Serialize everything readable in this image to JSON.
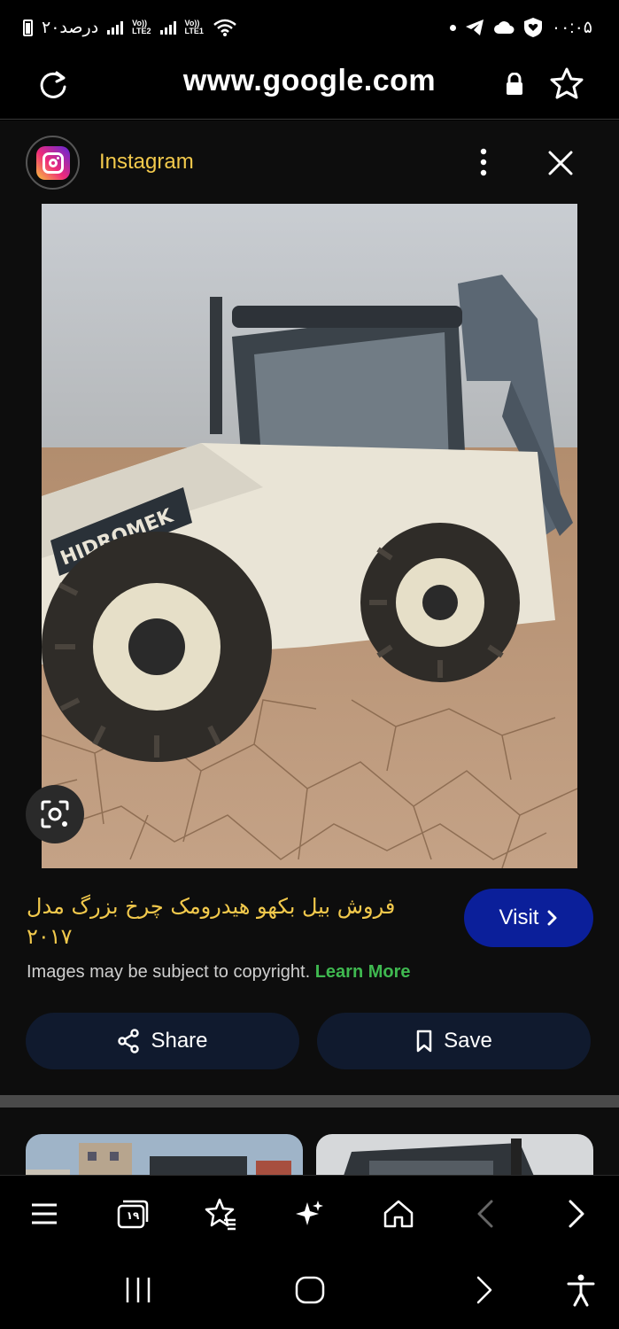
{
  "status": {
    "battery_text": "۲۰درصد",
    "sim2": {
      "top": "Vo))",
      "bottom": "LTE2"
    },
    "sim1": {
      "top": "Vo))",
      "bottom": "LTE1"
    },
    "time": "۰۰:۰۵"
  },
  "address_bar": {
    "url": "www.google.com"
  },
  "card": {
    "source_name": "Instagram",
    "title": "فروش بیل بکهو هیدرومک چرخ بزرگ مدل ۲۰۱۷",
    "visit_label": "Visit",
    "copyright_text": "Images may be subject to copyright.",
    "learn_more_label": "Learn More",
    "share_label": "Share",
    "save_label": "Save"
  },
  "toolbar_icons": [
    "menu-icon",
    "tabs-icon",
    "bookmarks-icon",
    "ai-sparkle-icon",
    "home-icon",
    "back-icon",
    "forward-icon"
  ],
  "toolbar": {
    "tabs_count": "۱۹"
  },
  "navbar_icons": [
    "recent-apps-icon",
    "home-circle-icon",
    "back-chevron-icon",
    "accessibility-icon"
  ]
}
